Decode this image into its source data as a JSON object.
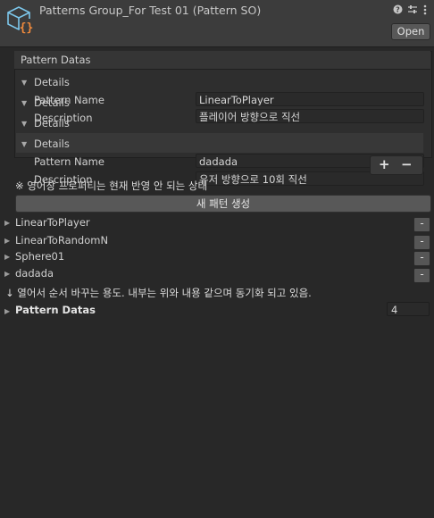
{
  "header": {
    "title": "Patterns Group_For Test 01 (Pattern SO)",
    "help_icon": "help-icon",
    "settings_icon": "sliders-icon",
    "menu_icon": "kebab-menu-icon",
    "open_label": "Open"
  },
  "panel": {
    "title": "Pattern Datas",
    "details_label": "Details",
    "pattern_name_label": "Pattern Name",
    "description_label": "Description",
    "items": [
      {
        "name": "LinearToPlayer",
        "description": "플레이어 방향으로 직선"
      },
      {
        "name": "dadada",
        "description": "유저 방향으로 10회 직선"
      }
    ],
    "plus_label": "+",
    "minus_label": "−"
  },
  "note": "※ 영어창 프로퍼티는 현재 반영 안 되는 상태",
  "new_pattern_button": "새 패턴 생성",
  "list": [
    {
      "label": "LinearToPlayer",
      "remove": "-"
    },
    {
      "label": "LinearToRandomN",
      "remove": "-"
    },
    {
      "label": "Sphere01",
      "remove": "-"
    },
    {
      "label": "dadada",
      "remove": "-"
    }
  ],
  "sync_note": "↓ 열어서 순서 바꾸는 용도. 내부는 위와 내용 같으며 동기화 되고 있음.",
  "pattern_datas": {
    "label": "Pattern Datas",
    "count": "4"
  },
  "colors": {
    "background": "#282828",
    "header": "#3c3c3c",
    "button": "#585858",
    "field": "#2a2a2a"
  }
}
